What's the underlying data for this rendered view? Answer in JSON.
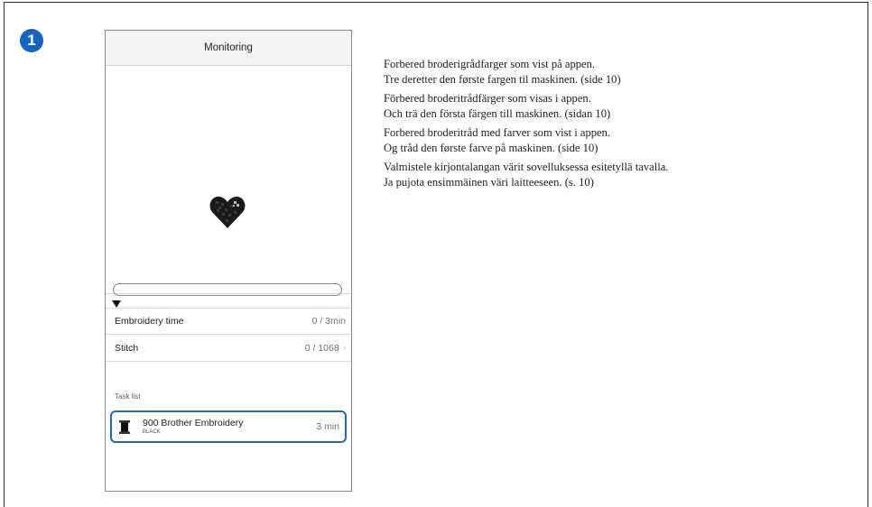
{
  "step": {
    "number": "1"
  },
  "phone": {
    "title": "Monitoring",
    "progress": 0,
    "embroidery_time": {
      "label": "Embroidery time",
      "value": "0 / 3min"
    },
    "stitch": {
      "label": "Stitch",
      "value": "0 / 1068"
    },
    "task_list_title": "Task list",
    "task": {
      "name": "900 Brother Embroidery",
      "color": "BLACK",
      "time": "3 min"
    }
  },
  "notes": [
    {
      "line1": "Forbered broderigrådfarger som vist på appen.",
      "line2": "Tre deretter den første fargen til maskinen. (side 10)"
    },
    {
      "line1": "Förbered broderitrådfärger som visas i appen.",
      "line2": "Och trä den första färgen till maskinen. (sidan 10)"
    },
    {
      "line1": "Forbered broderitråd med farver som vist i appen.",
      "line2": "Og tråd den første farve på maskinen. (side 10)"
    },
    {
      "line1": "Valmistele kirjontalangan värit sovelluksessa esitetyllä tavalla.",
      "line2": "Ja pujota ensimmäinen väri laitteeseen. (s. 10)"
    }
  ],
  "colors": {
    "accent": "#1e6ab8",
    "badge": "#1565c0",
    "thread": "#111111"
  },
  "icons": [
    "heart-design-icon",
    "progress-marker-icon",
    "chevron-right-icon",
    "thread-spool-icon"
  ]
}
